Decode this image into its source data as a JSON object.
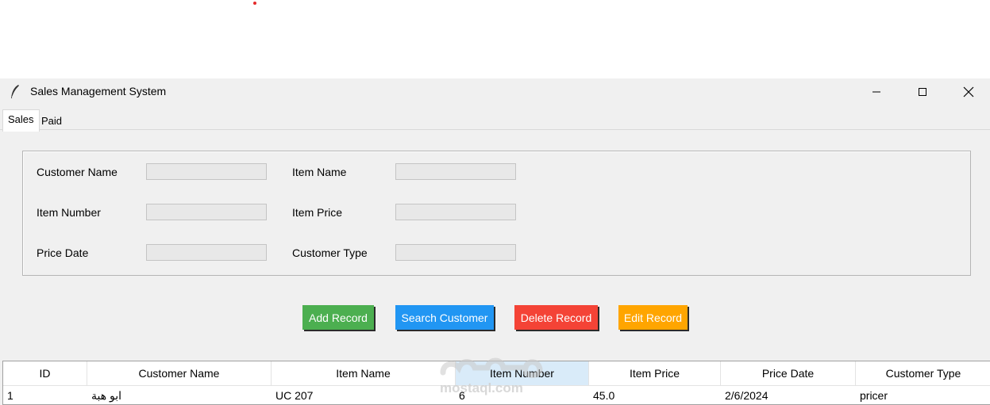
{
  "window": {
    "title": "Sales Management System"
  },
  "tabs": [
    {
      "label": "Sales",
      "active": true
    },
    {
      "label": "Paid",
      "active": false
    }
  ],
  "form": {
    "customer_name": {
      "label": "Customer Name",
      "value": ""
    },
    "item_name": {
      "label": "Item Name",
      "value": ""
    },
    "item_number": {
      "label": "Item Number",
      "value": ""
    },
    "item_price": {
      "label": "Item Price",
      "value": ""
    },
    "price_date": {
      "label": "Price Date",
      "value": ""
    },
    "customer_type": {
      "label": "Customer Type",
      "value": ""
    }
  },
  "buttons": {
    "add": {
      "label": "Add Record",
      "color": "#4caf50"
    },
    "search": {
      "label": "Search Customer",
      "color": "#2196f3"
    },
    "delete": {
      "label": "Delete Record",
      "color": "#f44336"
    },
    "edit": {
      "label": "Edit Record",
      "color": "#ffa500"
    }
  },
  "table": {
    "columns": [
      "ID",
      "Customer Name",
      "Item Name",
      "Item Number",
      "Item Price",
      "Price Date",
      "Customer Type"
    ],
    "rows": [
      [
        "1",
        "ابو هبة",
        "UC 207",
        "6",
        "45.0",
        "2/6/2024",
        "pricer"
      ]
    ]
  },
  "watermark": "mostaql.com"
}
